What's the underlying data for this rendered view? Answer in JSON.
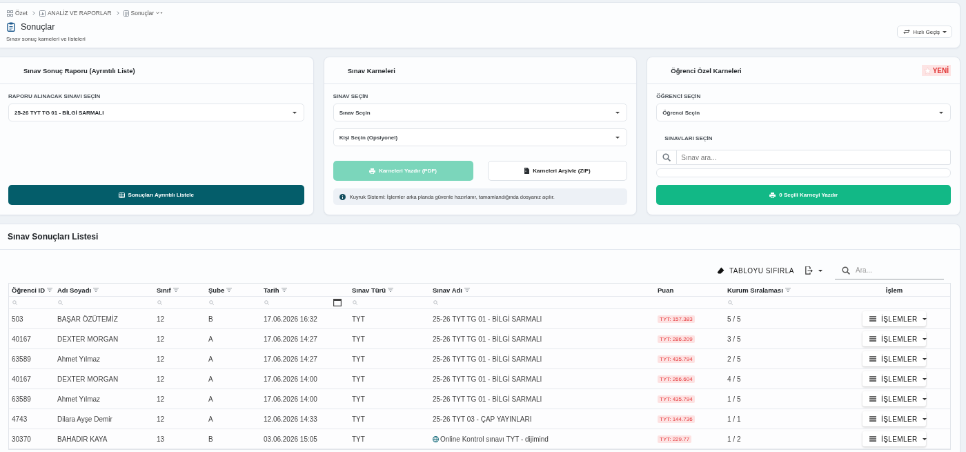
{
  "breadcrumb": [
    {
      "label": "Özet",
      "expandable": false
    },
    {
      "label": "ANALİZ VE RAPORLAR",
      "expandable": false
    },
    {
      "label": "Sonuçlar",
      "expandable": true
    }
  ],
  "page_header": {
    "title": "Sonuçlar",
    "subtitle": "Sınav sonuç karneleri ve listeleri",
    "quick_nav": "Hızlı Geçiş"
  },
  "cards": [
    {
      "title": "Sınav Sonuç Raporu (Ayrıntılı Liste)",
      "blocks": [
        {
          "kind": "label",
          "text": "RAPORU ALINACAK SINAVI SEÇİN"
        },
        {
          "kind": "select",
          "value": "25-26 TYT TG 01 - BİLGİ SARMALI"
        },
        {
          "kind": "buttons",
          "buttons": [
            {
              "kind": "dark",
              "label": "Sonuçları Ayrıntılı Listele",
              "disabled": false
            }
          ]
        }
      ]
    },
    {
      "title": "Sınav Karneleri",
      "blocks": [
        {
          "kind": "label",
          "text": "SINAV SEÇİN"
        },
        {
          "kind": "select",
          "placeholder": "Sınav Seçin"
        },
        {
          "kind": "select",
          "placeholder": "Kişi Seçin (Opsiyonel)"
        },
        {
          "kind": "buttons",
          "buttons": [
            {
              "kind": "success",
              "label": "Karneleri Yazdır (PDF)",
              "disabled": true
            },
            {
              "kind": "outline",
              "label": "Karneleri Arşivle (ZIP)",
              "disabled": false
            }
          ]
        },
        {
          "kind": "note",
          "text": "Kuyruk Sistemi: İşlemler arka planda güvenle hazırlanır, tamamlandığında dosyanız açılır."
        }
      ]
    },
    {
      "title": "Öğrenci Özel Karneleri",
      "badge": "YENİ",
      "blocks": [
        {
          "kind": "label",
          "text": "ÖĞRENCİ SEÇİN"
        },
        {
          "kind": "select",
          "placeholder": "Öğrenci Seçin"
        },
        {
          "kind": "sublabel",
          "text": "SINAVLARI SEÇİN"
        },
        {
          "kind": "search",
          "placeholder": "Sınav ara..."
        },
        {
          "kind": "list"
        },
        {
          "kind": "buttons",
          "buttons": [
            {
              "kind": "success",
              "label": "0 Seçili Karneyi Yazdır",
              "disabled": false
            }
          ]
        }
      ]
    }
  ],
  "results": {
    "title": "Sınav Sonuçları Listesi",
    "toolbar": {
      "reset": "TABLOYU SIFIRLA",
      "search_placeholder": "Ara..."
    },
    "columns": [
      {
        "label": "Öğrenci ID",
        "kind": "text",
        "filter": true,
        "searchable": true
      },
      {
        "label": "Adı Soyadı",
        "kind": "text",
        "filter": true,
        "searchable": true
      },
      {
        "label": "Sınıf",
        "kind": "text",
        "filter": true,
        "searchable": true
      },
      {
        "label": "Şube",
        "kind": "text",
        "filter": true,
        "searchable": true
      },
      {
        "label": "Tarih",
        "kind": "date",
        "filter": true,
        "searchable": true
      },
      {
        "label": "Sınav Türü",
        "kind": "text",
        "filter": true,
        "searchable": true
      },
      {
        "label": "Sınav Adı",
        "kind": "exam",
        "filter": true,
        "searchable": true
      },
      {
        "label": "Puan",
        "kind": "score",
        "filter": false,
        "searchable": false
      },
      {
        "label": "Kurum Sıralaması",
        "kind": "text",
        "filter": true,
        "searchable": true
      },
      {
        "label": "İşlem",
        "kind": "action",
        "filter": false,
        "searchable": false
      }
    ],
    "rows": [
      {
        "cells": [
          "503",
          "BAŞAR ÖZÜTEMİZ",
          "12",
          "B",
          "17.06.2026 16:32",
          "TYT",
          "25-26 TYT TG 01 - BİLGİ SARMALI",
          "TYT: 157.383",
          "5 / 5"
        ],
        "action": "İŞLEMLER",
        "online": false
      },
      {
        "cells": [
          "40167",
          "DEXTER MORGAN",
          "12",
          "A",
          "17.06.2026 14:27",
          "TYT",
          "25-26 TYT TG 01 - BİLGİ SARMALI",
          "TYT: 286.209",
          "3 / 5"
        ],
        "action": "İŞLEMLER",
        "online": false
      },
      {
        "cells": [
          "63589",
          "Ahmet Yılmaz",
          "12",
          "A",
          "17.06.2026 14:27",
          "TYT",
          "25-26 TYT TG 01 - BİLGİ SARMALI",
          "TYT: 435.794",
          "2 / 5"
        ],
        "action": "İŞLEMLER",
        "online": false
      },
      {
        "cells": [
          "40167",
          "DEXTER MORGAN",
          "12",
          "A",
          "17.06.2026 14:00",
          "TYT",
          "25-26 TYT TG 01 - BİLGİ SARMALI",
          "TYT: 266.604",
          "4 / 5"
        ],
        "action": "İŞLEMLER",
        "online": false
      },
      {
        "cells": [
          "63589",
          "Ahmet Yılmaz",
          "12",
          "A",
          "17.06.2026 14:00",
          "TYT",
          "25-26 TYT TG 01 - BİLGİ SARMALI",
          "TYT: 435.794",
          "1 / 5"
        ],
        "action": "İŞLEMLER",
        "online": false
      },
      {
        "cells": [
          "4743",
          "Dilara Ayşe Demir",
          "12",
          "A",
          "12.06.2026 14:33",
          "TYT",
          "25-26 TYT 03 - ÇAP YAYINLARI",
          "TYT: 144.736",
          "1 / 1"
        ],
        "action": "İŞLEMLER",
        "online": false
      },
      {
        "cells": [
          "30370",
          "BAHADIR KAYA",
          "13",
          "B",
          "03.06.2026 15:05",
          "TYT",
          "Online Kontrol sınavı TYT - dijimind",
          "TYT: 229.77",
          "1 / 2"
        ],
        "action": "İŞLEMLER",
        "online": true
      }
    ]
  }
}
